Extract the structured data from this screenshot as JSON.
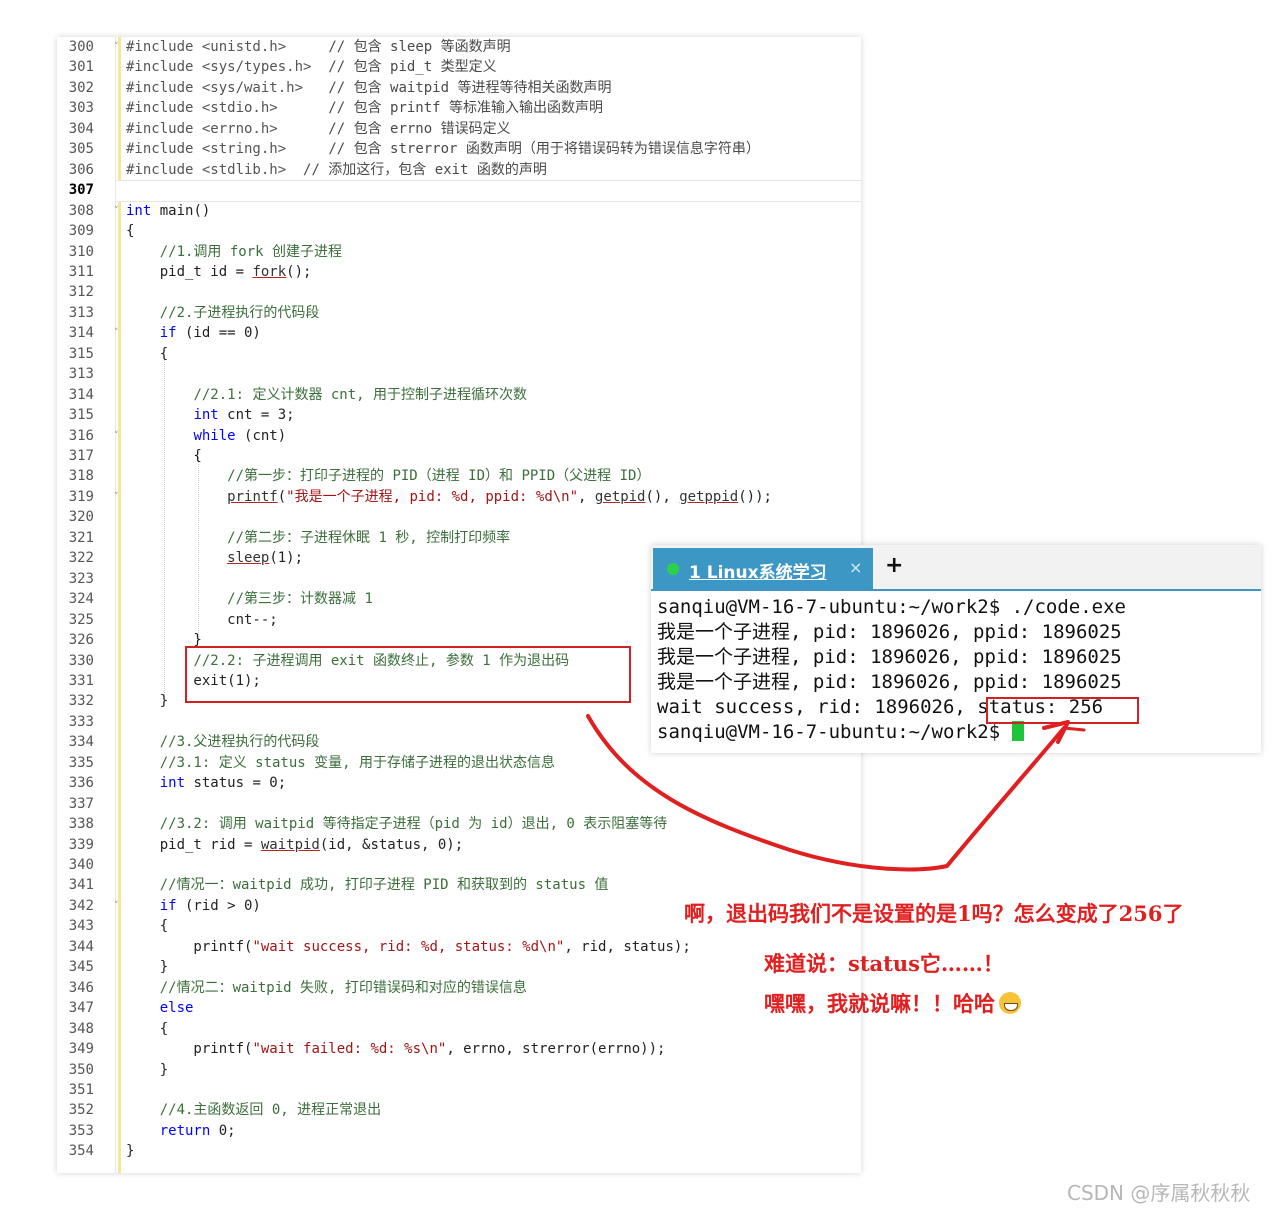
{
  "editor": {
    "line_numbers": [
      "300",
      "301",
      "302",
      "303",
      "304",
      "305",
      "306",
      "307",
      "308",
      "309",
      "310",
      "311",
      "312",
      "313",
      "314",
      "315",
      "313",
      "314",
      "315",
      "316",
      "317",
      "318",
      "319",
      "320",
      "321",
      "322",
      "323",
      "324",
      "325",
      "326",
      "330",
      "331",
      "332",
      "333",
      "334",
      "335",
      "336",
      "337",
      "338",
      "339",
      "340",
      "341",
      "342",
      "343",
      "344",
      "345",
      "346",
      "347",
      "348",
      "349",
      "350",
      "351",
      "352",
      "353",
      "354"
    ],
    "current_line": "307",
    "lines": [
      [
        {
          "c": "inc",
          "t": "#include <unistd.h>"
        },
        {
          "c": "",
          "t": "     "
        },
        {
          "c": "cm2",
          "t": "// 包含 sleep 等函数声明"
        }
      ],
      [
        {
          "c": "inc",
          "t": "#include <sys/types.h>"
        },
        {
          "c": "",
          "t": "  "
        },
        {
          "c": "cm2",
          "t": "// 包含 pid_t 类型定义"
        }
      ],
      [
        {
          "c": "inc",
          "t": "#include <sys/wait.h>"
        },
        {
          "c": "",
          "t": "   "
        },
        {
          "c": "cm2",
          "t": "// 包含 waitpid 等进程等待相关函数声明"
        }
      ],
      [
        {
          "c": "inc",
          "t": "#include <stdio.h>"
        },
        {
          "c": "",
          "t": "      "
        },
        {
          "c": "cm2",
          "t": "// 包含 printf 等标准输入输出函数声明"
        }
      ],
      [
        {
          "c": "inc",
          "t": "#include <errno.h>"
        },
        {
          "c": "",
          "t": "      "
        },
        {
          "c": "cm2",
          "t": "// 包含 errno 错误码定义"
        }
      ],
      [
        {
          "c": "inc",
          "t": "#include <string.h>"
        },
        {
          "c": "",
          "t": "     "
        },
        {
          "c": "cm2",
          "t": "// 包含 strerror 函数声明（用于将错误码转为错误信息字符串）"
        }
      ],
      [
        {
          "c": "inc",
          "t": "#include <stdlib.h>"
        },
        {
          "c": "",
          "t": "  "
        },
        {
          "c": "cm2",
          "t": "// 添加这行，包含 exit 函数的声明"
        }
      ],
      [],
      [
        {
          "c": "kw",
          "t": "int"
        },
        {
          "c": "",
          "t": " main()"
        }
      ],
      [
        {
          "c": "",
          "t": "{"
        }
      ],
      [
        {
          "c": "",
          "t": "    "
        },
        {
          "c": "cm",
          "t": "//1.调用 fork 创建子进程"
        }
      ],
      [
        {
          "c": "",
          "t": "    pid_t id = "
        },
        {
          "c": "fn",
          "t": "fork"
        },
        {
          "c": "",
          "t": "();"
        }
      ],
      [],
      [
        {
          "c": "",
          "t": "    "
        },
        {
          "c": "cm",
          "t": "//2.子进程执行的代码段"
        }
      ],
      [
        {
          "c": "",
          "t": "    "
        },
        {
          "c": "kw",
          "t": "if"
        },
        {
          "c": "",
          "t": " (id == 0)"
        }
      ],
      [
        {
          "c": "",
          "t": "    {"
        }
      ],
      [],
      [
        {
          "c": "",
          "t": "        "
        },
        {
          "c": "cm",
          "t": "//2.1: 定义计数器 cnt, 用于控制子进程循环次数"
        }
      ],
      [
        {
          "c": "",
          "t": "        "
        },
        {
          "c": "kw",
          "t": "int"
        },
        {
          "c": "",
          "t": " cnt = 3;"
        }
      ],
      [
        {
          "c": "",
          "t": "        "
        },
        {
          "c": "kw",
          "t": "while"
        },
        {
          "c": "",
          "t": " (cnt)"
        }
      ],
      [
        {
          "c": "",
          "t": "        {"
        }
      ],
      [
        {
          "c": "",
          "t": "            "
        },
        {
          "c": "cm",
          "t": "//第一步：打印子进程的 PID（进程 ID）和 PPID（父进程 ID）"
        }
      ],
      [
        {
          "c": "",
          "t": "            "
        },
        {
          "c": "fn",
          "t": "printf"
        },
        {
          "c": "",
          "t": "("
        },
        {
          "c": "str",
          "t": "\"我是一个子进程, pid: %d, ppid: %d\\n\""
        },
        {
          "c": "",
          "t": ", "
        },
        {
          "c": "fn",
          "t": "getpid"
        },
        {
          "c": "",
          "t": "(), "
        },
        {
          "c": "fn",
          "t": "getppid"
        },
        {
          "c": "",
          "t": "());"
        }
      ],
      [],
      [
        {
          "c": "",
          "t": "            "
        },
        {
          "c": "cm",
          "t": "//第二步：子进程休眠 1 秒, 控制打印频率"
        }
      ],
      [
        {
          "c": "",
          "t": "            "
        },
        {
          "c": "fn",
          "t": "sleep"
        },
        {
          "c": "",
          "t": "(1);"
        }
      ],
      [],
      [
        {
          "c": "",
          "t": "            "
        },
        {
          "c": "cm",
          "t": "//第三步：计数器减 1"
        }
      ],
      [
        {
          "c": "",
          "t": "            cnt--;"
        }
      ],
      [
        {
          "c": "",
          "t": "        }"
        }
      ],
      [
        {
          "c": "",
          "t": "        "
        },
        {
          "c": "cm",
          "t": "//2.2: 子进程调用 exit 函数终止, 参数 1 作为退出码"
        }
      ],
      [
        {
          "c": "",
          "t": "        exit(1);"
        }
      ],
      [
        {
          "c": "",
          "t": "    }"
        }
      ],
      [],
      [
        {
          "c": "",
          "t": "    "
        },
        {
          "c": "cm",
          "t": "//3.父进程执行的代码段"
        }
      ],
      [
        {
          "c": "",
          "t": "    "
        },
        {
          "c": "cm",
          "t": "//3.1: 定义 status 变量, 用于存储子进程的退出状态信息"
        }
      ],
      [
        {
          "c": "",
          "t": "    "
        },
        {
          "c": "kw",
          "t": "int"
        },
        {
          "c": "",
          "t": " status = 0;"
        }
      ],
      [],
      [
        {
          "c": "",
          "t": "    "
        },
        {
          "c": "cm",
          "t": "//3.2: 调用 waitpid 等待指定子进程（pid 为 id）退出, 0 表示阻塞等待"
        }
      ],
      [
        {
          "c": "",
          "t": "    pid_t rid = "
        },
        {
          "c": "fn",
          "t": "waitpid"
        },
        {
          "c": "",
          "t": "(id, &status, 0);"
        }
      ],
      [],
      [
        {
          "c": "",
          "t": "    "
        },
        {
          "c": "cm",
          "t": "//情况一：waitpid 成功, 打印子进程 PID 和获取到的 status 值"
        }
      ],
      [
        {
          "c": "",
          "t": "    "
        },
        {
          "c": "kw",
          "t": "if"
        },
        {
          "c": "",
          "t": " (rid > 0)"
        }
      ],
      [
        {
          "c": "",
          "t": "    {"
        }
      ],
      [
        {
          "c": "",
          "t": "        printf("
        },
        {
          "c": "str",
          "t": "\"wait success, rid: %d, status: %d\\n\""
        },
        {
          "c": "",
          "t": ", rid, status);"
        }
      ],
      [
        {
          "c": "",
          "t": "    }"
        }
      ],
      [
        {
          "c": "",
          "t": "    "
        },
        {
          "c": "cm",
          "t": "//情况二：waitpid 失败, 打印错误码和对应的错误信息"
        }
      ],
      [
        {
          "c": "",
          "t": "    "
        },
        {
          "c": "kw",
          "t": "else"
        }
      ],
      [
        {
          "c": "",
          "t": "    {"
        }
      ],
      [
        {
          "c": "",
          "t": "        printf("
        },
        {
          "c": "str",
          "t": "\"wait failed: %d: %s\\n\""
        },
        {
          "c": "",
          "t": ", errno, strerror(errno));"
        }
      ],
      [
        {
          "c": "",
          "t": "    }"
        }
      ],
      [],
      [
        {
          "c": "",
          "t": "    "
        },
        {
          "c": "cm",
          "t": "//4.主函数返回 0, 进程正常退出"
        }
      ],
      [
        {
          "c": "",
          "t": "    "
        },
        {
          "c": "kw",
          "t": "return"
        },
        {
          "c": "",
          "t": " 0;"
        }
      ],
      [
        {
          "c": "",
          "t": "}"
        }
      ]
    ]
  },
  "terminal": {
    "tab_label": "1 Linux系统学习",
    "tab_close": "×",
    "tab_add": "+",
    "lines": [
      "sanqiu@VM-16-7-ubuntu:~/work2$ ./code.exe",
      "我是一个子进程, pid: 1896026, ppid: 1896025",
      "我是一个子进程, pid: 1896026, ppid: 1896025",
      "我是一个子进程, pid: 1896026, ppid: 1896025",
      "wait success, rid: 1896026, status: 256"
    ],
    "prompt_last": "sanqiu@VM-16-7-ubuntu:~/work2$ "
  },
  "annotations": {
    "line1": "啊，退出码我们不是设置的是1吗？怎么变成了256了",
    "line2": "难道说：status它……！",
    "line3": "嘿嘿，我就说嘛！！哈哈"
  },
  "watermark": "CSDN @序属秋秋秋",
  "colors": {
    "annotation_red": "#e02020",
    "tab_blue": "#3d97c4",
    "cursor_green": "#1ec43a",
    "keyword_blue": "#0000ff"
  }
}
